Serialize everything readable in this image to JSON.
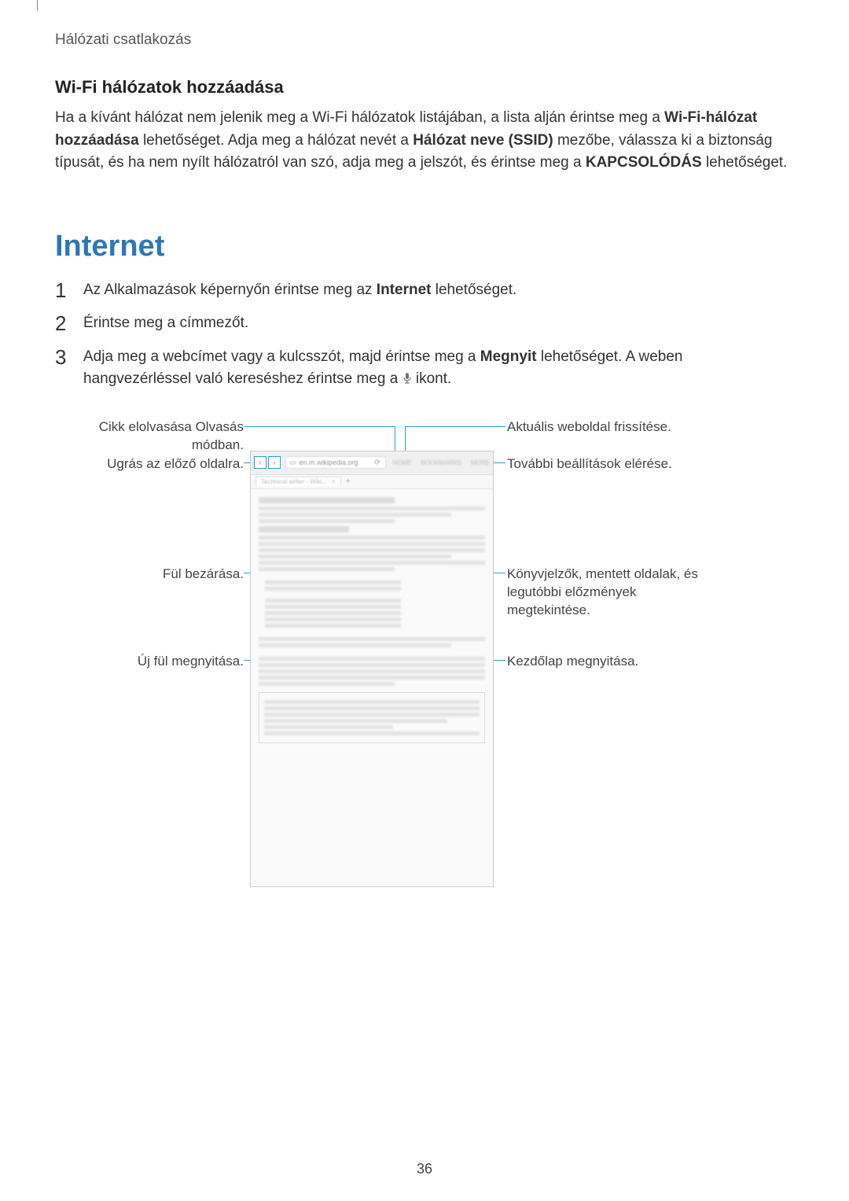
{
  "sectionLabel": "Hálózati csatlakozás",
  "wifi": {
    "heading": "Wi-Fi hálózatok hozzáadása",
    "para_pre": "Ha a kívánt hálózat nem jelenik meg a Wi-Fi hálózatok listájában, a lista alján érintse meg a ",
    "bold1": "Wi-Fi-hálózat hozzáadása",
    "mid1": " lehetőséget. Adja meg a hálózat nevét a ",
    "bold2": "Hálózat neve (SSID)",
    "mid2": " mezőbe, válassza ki a biztonság típusát, és ha nem nyílt hálózatról van szó, adja meg a jelszót, és érintse meg a ",
    "bold3": "KAPCSOLÓDÁS",
    "tail": " lehetőséget."
  },
  "internet": {
    "heading": "Internet",
    "steps": {
      "s1_pre": "Az Alkalmazások képernyőn érintse meg az ",
      "s1_bold": "Internet",
      "s1_tail": " lehetőséget.",
      "s2": "Érintse meg a címmezőt.",
      "s3_pre": "Adja meg a webcímet vagy a kulcsszót, majd érintse meg a ",
      "s3_bold": "Megnyit",
      "s3_mid": " lehetőséget. A weben hangvezérléssel való kereséshez érintse meg a ",
      "s3_tail": " ikont."
    },
    "numbers": {
      "n1": "1",
      "n2": "2",
      "n3": "3"
    }
  },
  "annotations": {
    "left1": "Cikk elolvasása Olvasás módban.",
    "left2": "Ugrás az előző oldalra.",
    "left3": "Fül bezárása.",
    "left4": "Új fül megnyitása.",
    "right1": "Aktuális weboldal frissítése.",
    "right2": "További beállítások elérése.",
    "right3": "Könyvjelzők, mentett oldalak, és legutóbbi előzmények megtekintése.",
    "right4": "Kezdőlap megnyitása."
  },
  "browser": {
    "url": "en.m.wikipedia.org",
    "tabLabel": "Technical writer - Wiki...",
    "menu": {
      "m1": "HOME",
      "m2": "BOOKMARKS",
      "m3": "MORE"
    },
    "nav": {
      "back": "‹",
      "fwd": "›",
      "close": "×",
      "plus": "+",
      "refresh": "⟳"
    }
  },
  "pageNumber": "36"
}
